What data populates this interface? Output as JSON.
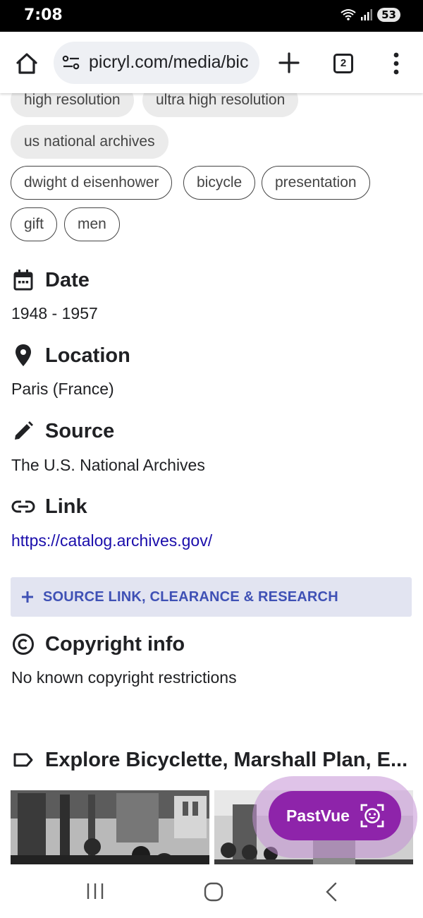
{
  "status_bar": {
    "time": "7:08",
    "battery": "53"
  },
  "browser": {
    "url": "picryl.com/media/bic",
    "tab_count": "2"
  },
  "tags": {
    "filled": [
      "high resolution",
      "ultra high resolution",
      "us national archives"
    ],
    "outlined": [
      "dwight d eisenhower",
      "bicycle",
      "presentation",
      "gift",
      "men"
    ]
  },
  "details": {
    "date": {
      "heading": "Date",
      "value": "1948 - 1957"
    },
    "location": {
      "heading": "Location",
      "value": "Paris (France)"
    },
    "source": {
      "heading": "Source",
      "value": "The U.S. National Archives"
    },
    "link": {
      "heading": "Link",
      "value": "https://catalog.archives.gov/"
    },
    "expand_label": "SOURCE LINK, CLEARANCE & RESEARCH",
    "copyright": {
      "heading": "Copyright info",
      "value": "No known copyright restrictions"
    }
  },
  "explore": {
    "heading": "Explore Bicyclette, Marshall Plan, E..."
  },
  "pastvue": {
    "label": "PastVue"
  },
  "colors": {
    "accent_purple": "#8e24aa",
    "link_blue": "#1a0dab",
    "expand_text": "#3f51b5",
    "expand_bg": "#e2e4f1"
  },
  "icons": [
    "home-icon",
    "site-settings-icon",
    "plus-icon",
    "tabs-icon",
    "more-vert-icon",
    "calendar-icon",
    "location-pin-icon",
    "pencil-icon",
    "link-icon",
    "copyright-icon",
    "label-icon",
    "face-scan-icon",
    "recents-icon",
    "home-nav-icon",
    "back-icon"
  ]
}
